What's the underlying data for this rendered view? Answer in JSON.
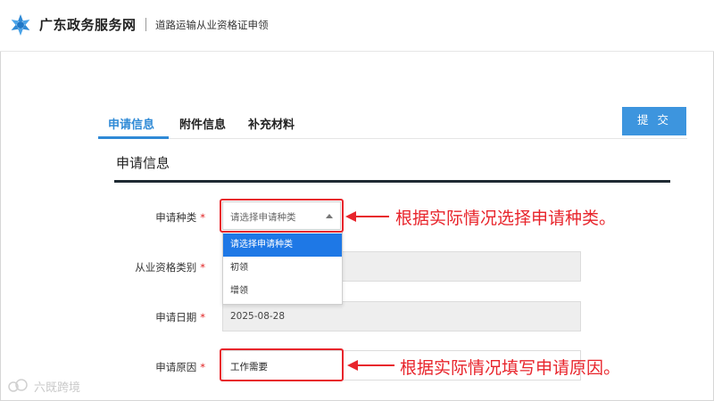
{
  "header": {
    "site_title": "广东政务服务网",
    "service_title": "道路运输从业资格证申领"
  },
  "tabs": [
    {
      "label": "申请信息",
      "active": true
    },
    {
      "label": "附件信息",
      "active": false
    },
    {
      "label": "补充材料",
      "active": false
    }
  ],
  "submit_label": "提 交",
  "section_title": "申请信息",
  "form": {
    "apply_type": {
      "label": "申请种类",
      "placeholder": "请选择申请种类",
      "options": [
        "请选择申请种类",
        "初领",
        "增领"
      ]
    },
    "qualification_type": {
      "label": "从业资格类别",
      "value": ""
    },
    "apply_date": {
      "label": "申请日期",
      "value": "2025-08-28"
    },
    "apply_reason": {
      "label": "申请原因",
      "value": "工作需要"
    }
  },
  "annotations": {
    "select_hint": "根据实际情况选择申请种类。",
    "reason_hint": "根据实际情况填写申请原因。"
  },
  "watermark": "六既跨境",
  "colors": {
    "accent": "#2f8ad6",
    "submit": "#3d95de",
    "highlight": "#e8252c",
    "dropdown_selected": "#1e78e6",
    "required": "#e02020"
  },
  "icons": {
    "logo": "guangdong-gov-logo-icon",
    "caret": "caret-up-icon",
    "arrow": "left-arrow-icon"
  }
}
